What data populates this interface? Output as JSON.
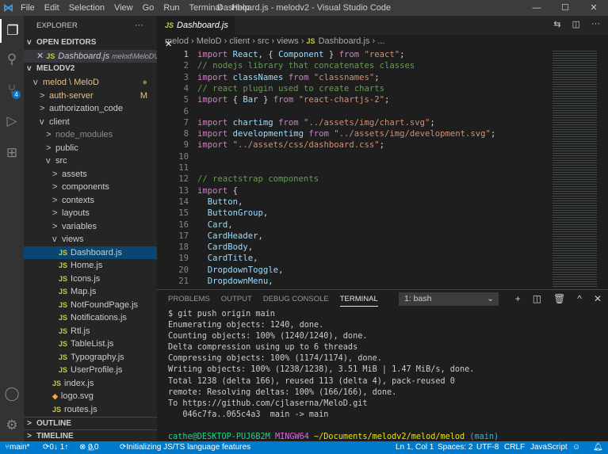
{
  "title": "Dashboard.js - melodv2 - Visual Studio Code",
  "menu": [
    "File",
    "Edit",
    "Selection",
    "View",
    "Go",
    "Run",
    "Terminal",
    "Help"
  ],
  "scm_badge": "4",
  "sidebar": {
    "explorer": "EXPLORER",
    "more": "···",
    "open_editors": "OPEN EDITORS",
    "open_file": "Dashboard.js",
    "open_path": "melod\\MeloD\\...",
    "workspace": "MELODV2",
    "outline": "OUTLINE",
    "timeline": "TIMELINE",
    "tree": [
      {
        "label": "melod \\ MeloD",
        "d": 1,
        "chev": "v",
        "color": "#e2c08d",
        "deco": "●"
      },
      {
        "label": "auth-server",
        "d": 2,
        "chev": ">",
        "color": "#e2c08d",
        "deco": "M"
      },
      {
        "label": "authorization_code",
        "d": 2,
        "chev": ">"
      },
      {
        "label": "client",
        "d": 2,
        "chev": "v"
      },
      {
        "label": "node_modules",
        "d": 3,
        "chev": ">",
        "color": "#8c8c8c"
      },
      {
        "label": "public",
        "d": 3,
        "chev": ">"
      },
      {
        "label": "src",
        "d": 3,
        "chev": "v"
      },
      {
        "label": "assets",
        "d": 4,
        "chev": ">"
      },
      {
        "label": "components",
        "d": 4,
        "chev": ">"
      },
      {
        "label": "contexts",
        "d": 4,
        "chev": ">"
      },
      {
        "label": "layouts",
        "d": 4,
        "chev": ">"
      },
      {
        "label": "variables",
        "d": 4,
        "chev": ">"
      },
      {
        "label": "views",
        "d": 4,
        "chev": "v"
      },
      {
        "label": "Dashboard.js",
        "d": 5,
        "js": true,
        "selected": true
      },
      {
        "label": "Home.js",
        "d": 5,
        "js": true
      },
      {
        "label": "Icons.js",
        "d": 5,
        "js": true
      },
      {
        "label": "Map.js",
        "d": 5,
        "js": true
      },
      {
        "label": "NotFoundPage.js",
        "d": 5,
        "js": true
      },
      {
        "label": "Notifications.js",
        "d": 5,
        "js": true
      },
      {
        "label": "Rtl.js",
        "d": 5,
        "js": true
      },
      {
        "label": "TableList.js",
        "d": 5,
        "js": true
      },
      {
        "label": "Typography.js",
        "d": 5,
        "js": true
      },
      {
        "label": "UserProfile.js",
        "d": 5,
        "js": true
      },
      {
        "label": "index.js",
        "d": 4,
        "js": true
      },
      {
        "label": "logo.svg",
        "d": 4,
        "svg": true
      },
      {
        "label": "routes.js",
        "d": 4,
        "js": true
      }
    ]
  },
  "tab": {
    "label": "Dashboard.js",
    "js": "JS"
  },
  "breadcrumb": [
    "melod",
    "MeloD",
    "client",
    "src",
    "views",
    "Dashboard.js",
    "..."
  ],
  "code": [
    [
      [
        "import ",
        "k"
      ],
      [
        "React",
        "v"
      ],
      [
        ", { ",
        "p"
      ],
      [
        "Component",
        "v"
      ],
      [
        " } ",
        "p"
      ],
      [
        "from ",
        "k"
      ],
      [
        "\"react\"",
        "s"
      ],
      [
        ";",
        "p"
      ]
    ],
    [
      [
        "// nodejs library that concatenates classes",
        "c"
      ]
    ],
    [
      [
        "import ",
        "k"
      ],
      [
        "classNames ",
        "v"
      ],
      [
        "from ",
        "k"
      ],
      [
        "\"classnames\"",
        "s"
      ],
      [
        ";",
        "p"
      ]
    ],
    [
      [
        "// react plugin used to create charts",
        "c"
      ]
    ],
    [
      [
        "import ",
        "k"
      ],
      [
        "{ ",
        "p"
      ],
      [
        "Bar",
        "v"
      ],
      [
        " } ",
        "p"
      ],
      [
        "from ",
        "k"
      ],
      [
        "\"react-chartjs-2\"",
        "s"
      ],
      [
        ";",
        "p"
      ]
    ],
    [],
    [
      [
        "import ",
        "k"
      ],
      [
        "chartimg ",
        "v"
      ],
      [
        "from ",
        "k"
      ],
      [
        "\"../assets/img/chart.svg\"",
        "s"
      ],
      [
        ";",
        "p"
      ]
    ],
    [
      [
        "import ",
        "k"
      ],
      [
        "developmentimg ",
        "v"
      ],
      [
        "from ",
        "k"
      ],
      [
        "\"../assets/img/development.svg\"",
        "s"
      ],
      [
        ";",
        "p"
      ]
    ],
    [
      [
        "import ",
        "k"
      ],
      [
        "\"../assets/css/dashboard.css\"",
        "s"
      ],
      [
        ";",
        "p"
      ]
    ],
    [],
    [],
    [
      [
        "// reactstrap components",
        "c"
      ]
    ],
    [
      [
        "import ",
        "k"
      ],
      [
        "{",
        "p"
      ]
    ],
    [
      [
        "  Button",
        "v"
      ],
      [
        ",",
        "p"
      ]
    ],
    [
      [
        "  ButtonGroup",
        "v"
      ],
      [
        ",",
        "p"
      ]
    ],
    [
      [
        "  Card",
        "v"
      ],
      [
        ",",
        "p"
      ]
    ],
    [
      [
        "  CardHeader",
        "v"
      ],
      [
        ",",
        "p"
      ]
    ],
    [
      [
        "  CardBody",
        "v"
      ],
      [
        ",",
        "p"
      ]
    ],
    [
      [
        "  CardTitle",
        "v"
      ],
      [
        ",",
        "p"
      ]
    ],
    [
      [
        "  DropdownToggle",
        "v"
      ],
      [
        ",",
        "p"
      ]
    ],
    [
      [
        "  DropdownMenu",
        "v"
      ],
      [
        ",",
        "p"
      ]
    ]
  ],
  "panel": {
    "tabs": [
      "PROBLEMS",
      "OUTPUT",
      "DEBUG CONSOLE",
      "TERMINAL"
    ],
    "terminal_select": "1: bash"
  },
  "terminal": {
    "lines": [
      "$ git push origin main",
      "Enumerating objects: 1240, done.",
      "Counting objects: 100% (1240/1240), done.",
      "Delta compression using up to 6 threads",
      "Compressing objects: 100% (1174/1174), done.",
      "Writing objects: 100% (1238/1238), 3.51 MiB | 1.47 MiB/s, done.",
      "Total 1238 (delta 166), reused 113 (delta 4), pack-reused 0",
      "remote: Resolving deltas: 100% (166/166), done.",
      "To https://github.com/cjlaserna/MeloD.git",
      "   046c7fa..065c4a3  main -> main",
      ""
    ],
    "user": "cathe@DESKTOP-PUJ6B2M",
    "shell": "MINGW64",
    "path": "~/Documents/melodv2/melod/melod",
    "branch": "(main)",
    "prompt": "$"
  },
  "status": {
    "branch": "main*",
    "sync": "0↓ 1↑",
    "errors": "0",
    "warnings": "0",
    "task": "Initializing JS/TS language features",
    "position": "Ln 1, Col 1",
    "spaces": "Spaces: 2",
    "encoding": "UTF-8",
    "eol": "CRLF",
    "language": "JavaScript"
  }
}
